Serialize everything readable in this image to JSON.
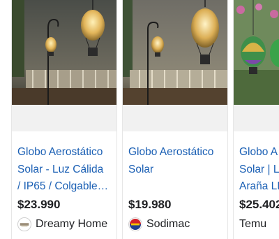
{
  "results": [
    {
      "title_lines": [
        "Globo Aerostático",
        "Solar - Luz Cálida",
        "/ IP65 / Colgable…"
      ],
      "price": "$23.990",
      "store": "Dreamy Home",
      "store_logo_icon": "dreamy-home-logo-icon"
    },
    {
      "title_lines": [
        "Globo Aerostático",
        "Solar"
      ],
      "price": "$19.980",
      "store": "Sodimac",
      "store_logo_icon": "sodimac-logo-icon"
    },
    {
      "title_lines": [
        "Globo A",
        "Solar | L",
        "Araña LI"
      ],
      "price": "$25.402",
      "store": "Temu",
      "store_logo_icon": ""
    }
  ],
  "colors": {
    "title_link": "#1a5fb4",
    "price_text": "#202124"
  }
}
